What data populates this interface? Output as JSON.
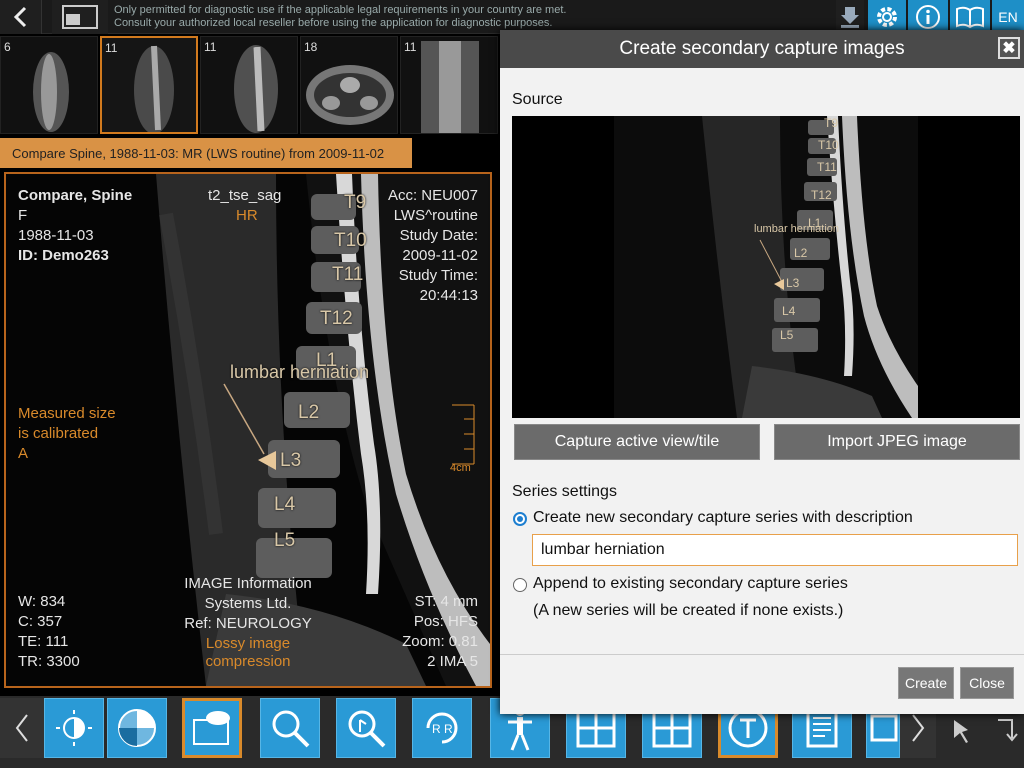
{
  "topbar": {
    "notice_line1": "Only permitted for diagnostic use if the applicable legal requirements in your country are met.",
    "notice_line2": "Consult your authorized local reseller before using the application for diagnostic purposes.",
    "lang": "EN",
    "icons": [
      "back-arrow-icon",
      "layout-icon",
      "download-icon",
      "gear-icon",
      "info-icon",
      "book-icon"
    ]
  },
  "thumbnails": [
    {
      "count": "6"
    },
    {
      "count": "11"
    },
    {
      "count": "11"
    },
    {
      "count": "18"
    },
    {
      "count": "11"
    }
  ],
  "compare_bar": "Compare Spine, 1988-11-03: MR (LWS routine) from 2009-11-02",
  "viewport": {
    "patient_name": "Compare, Spine",
    "sex": "F",
    "dob": "1988-11-03",
    "id": "ID: Demo263",
    "series": "t2_tse_sag",
    "hr": "HR",
    "acc": "Acc: NEU007",
    "study_desc": "LWS^routine",
    "study_date_label": "Study Date:",
    "study_date": "2009-11-02",
    "study_time_label": "Study Time:",
    "study_time": "20:44:13",
    "measured1": "Measured size",
    "measured2": "is calibrated",
    "measured3": "A",
    "scale": "4cm",
    "w": "W: 834",
    "c": "C: 357",
    "te": "TE: 111",
    "tr": "TR: 3300",
    "inst1": "IMAGE Information",
    "inst2": "Systems Ltd.",
    "ref": "Ref: NEUROLOGY",
    "lossy1": "Lossy image",
    "lossy2": "compression",
    "st": "ST: 4 mm",
    "pos": "Pos: HFS",
    "zoom": "Zoom: 0.81",
    "ima": "2 IMA 5",
    "labels": {
      "t9": "T9",
      "t10": "T10",
      "t11": "T11",
      "t12": "T12",
      "l1": "L1",
      "l2": "L2",
      "l3": "L3",
      "l4": "L4",
      "l5": "L5",
      "annot": "lumbar herniation"
    }
  },
  "dialog": {
    "title": "Create secondary capture images",
    "close_glyph": "✖",
    "source_label": "Source",
    "capture_btn": "Capture active view/tile",
    "import_btn": "Import JPEG image",
    "series_settings": "Series settings",
    "opt_new": "Create new secondary capture series with description",
    "desc_value": "lumbar herniation",
    "opt_append": "Append to existing secondary capture series",
    "opt_append_note": "(A new series will be created if none exists.)",
    "create_btn": "Create",
    "close_btn": "Close"
  },
  "toolbar": {
    "icons": [
      "contrast-icon",
      "window-level-icon",
      "annotation-icon",
      "zoom-icon",
      "pan-icon",
      "rotate-icon",
      "skeleton-icon",
      "grid-2x2-icon",
      "grid-layout-icon",
      "text-tool-icon",
      "report-icon",
      "screen-icon",
      "pin-icon",
      "corner-arrow-icon"
    ],
    "selected": [
      "annotation-icon",
      "text-tool-icon"
    ]
  }
}
